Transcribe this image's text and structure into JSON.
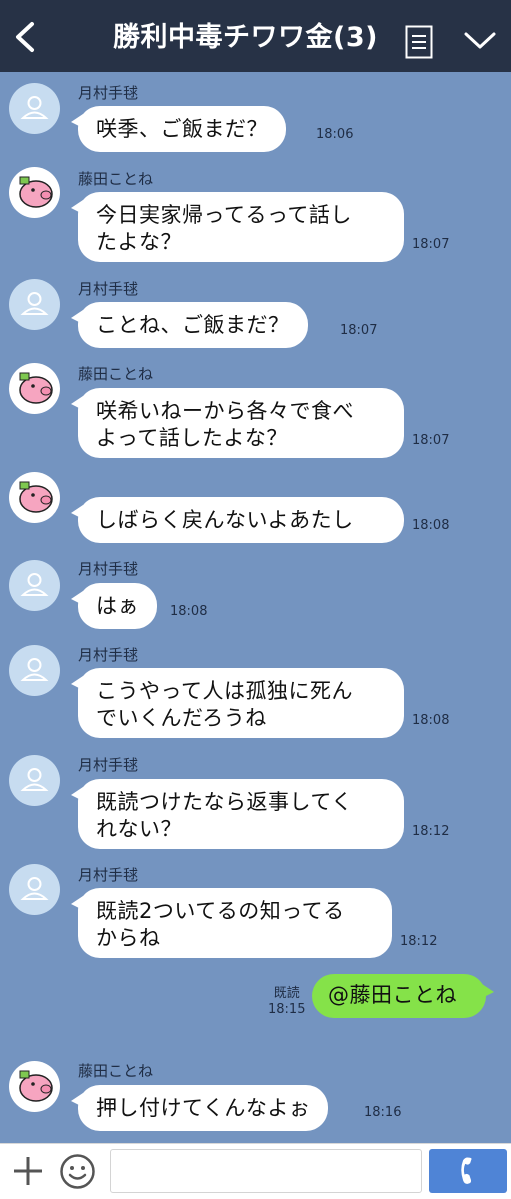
{
  "header": {
    "title": "勝利中毒チワワ金(3)"
  },
  "messages": [
    {
      "sender": "月村手毬",
      "avatar": "default",
      "text": "咲季、ご飯まだ？",
      "time": "18:06"
    },
    {
      "sender": "藤田ことね",
      "avatar": "pig",
      "text": "今日実家帰ってるって話し\nたよな？",
      "time": "18:07"
    },
    {
      "sender": "月村手毬",
      "avatar": "default",
      "text": "ことね、ご飯まだ？",
      "time": "18:07"
    },
    {
      "sender": "藤田ことね",
      "avatar": "pig",
      "text": "咲希いねーから各々で食べ\nよって話したよな？",
      "time": "18:07"
    },
    {
      "sender": "",
      "avatar": "pig",
      "text": "しばらく戻んないよあたし",
      "time": "18:08"
    },
    {
      "sender": "月村手毬",
      "avatar": "default",
      "text": "はぁ",
      "time": "18:08"
    },
    {
      "sender": "月村手毬",
      "avatar": "default",
      "text": "こうやって人は孤独に死ん\nでいくんだろうね",
      "time": "18:08"
    },
    {
      "sender": "月村手毬",
      "avatar": "default",
      "text": "既読つけたなら返事してく\nれない？",
      "time": "18:12"
    },
    {
      "sender": "月村手毬",
      "avatar": "default",
      "text": "既読2ついてるの知ってる\nからね",
      "time": "18:12"
    },
    {
      "sender": "藤田ことね",
      "avatar": "pig",
      "text": "押し付けてくんなよぉ",
      "time": "18:16"
    }
  ],
  "own_message": {
    "text": "@藤田ことね",
    "read_label": "既読",
    "time": "18:15"
  },
  "input": {
    "placeholder": ""
  },
  "colors": {
    "background": "#7494c0",
    "header": "#273246",
    "own_bubble": "#85e249",
    "call_button": "#4f84d6"
  },
  "icons": [
    "back-arrow-icon",
    "menu-icon",
    "chevron-down-icon",
    "plus-icon",
    "emoji-icon",
    "phone-icon",
    "default-avatar-icon",
    "pig-avatar-icon"
  ]
}
